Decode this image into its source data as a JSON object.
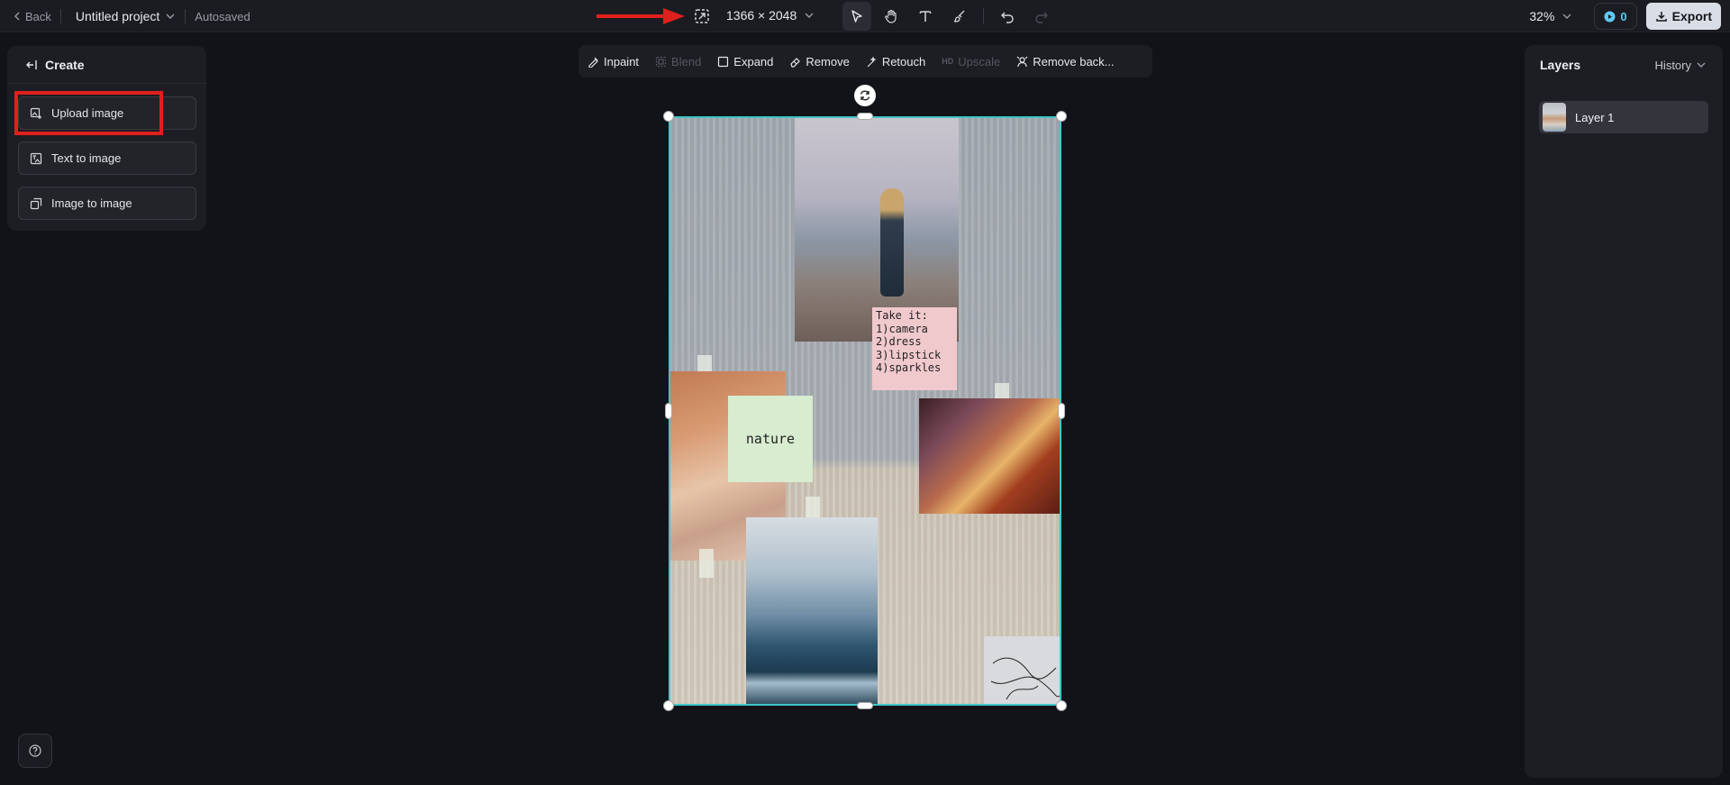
{
  "topbar": {
    "back_label": "Back",
    "project_name": "Untitled project",
    "save_status": "Autosaved",
    "canvas_size": "1366 × 2048",
    "zoom": "32%",
    "credits": "0",
    "export_label": "Export"
  },
  "tools": [
    {
      "name": "select-tool",
      "icon": "cursor-icon",
      "active": true
    },
    {
      "name": "hand-tool",
      "icon": "hand-icon",
      "active": false
    },
    {
      "name": "text-tool",
      "icon": "text-icon",
      "active": false
    },
    {
      "name": "brush-tool",
      "icon": "brush-icon",
      "active": false
    },
    {
      "name": "undo-button",
      "icon": "undo-icon",
      "active": false
    },
    {
      "name": "redo-button",
      "icon": "redo-icon",
      "disabled": true
    }
  ],
  "create_panel": {
    "title": "Create",
    "buttons": [
      {
        "label": "Upload image",
        "icon": "upload-image-icon"
      },
      {
        "label": "Text to image",
        "icon": "text-to-image-icon"
      },
      {
        "label": "Image to image",
        "icon": "image-to-image-icon"
      }
    ]
  },
  "edit_toolbar": {
    "items": [
      {
        "label": "Inpaint",
        "icon": "inpaint-icon",
        "disabled": false
      },
      {
        "label": "Blend",
        "icon": "blend-icon",
        "disabled": true
      },
      {
        "label": "Expand",
        "icon": "expand-icon",
        "disabled": false
      },
      {
        "label": "Remove",
        "icon": "eraser-icon",
        "disabled": false
      },
      {
        "label": "Retouch",
        "icon": "retouch-icon",
        "disabled": false
      },
      {
        "label": "Upscale",
        "icon": "hd-badge",
        "badge": "HD",
        "disabled": true
      },
      {
        "label": "Remove back...",
        "icon": "remove-background-icon",
        "disabled": false
      }
    ]
  },
  "layers_panel": {
    "title": "Layers",
    "history_label": "History",
    "layers": [
      {
        "label": "Layer 1"
      }
    ]
  },
  "canvas_content": {
    "pink_note": "Take it:\n1)camera\n2)dress\n3)lipstick\n4)sparkles",
    "green_note": "nature"
  },
  "colors": {
    "accent_selection": "#3fc6c9",
    "highlight_box": "#e0201c",
    "credits": "#5ec8f2"
  }
}
